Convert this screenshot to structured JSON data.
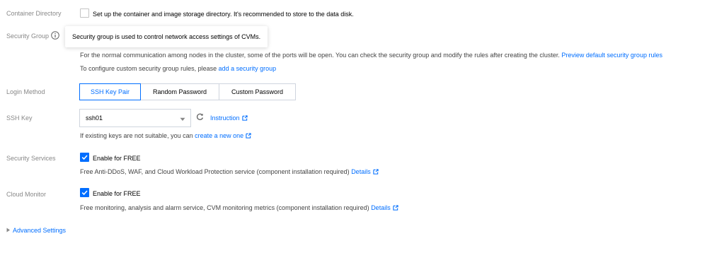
{
  "container_directory": {
    "label": "Container Directory",
    "checkbox_text": "Set up the container and image storage directory. It's recommended to store to the data disk.",
    "checked": false
  },
  "security_group": {
    "label": "Security Group",
    "info_icon": "info-circle-icon",
    "tooltip": "Security group is used to control network access settings of CVMs.",
    "description": "For the normal communication among nodes in the cluster, some of the ports will be open. You can check the security group and modify the rules after creating the cluster.",
    "preview_link": "Preview default security group rules",
    "custom_text": "To configure custom security group rules, please",
    "add_link": "add a security group"
  },
  "login_method": {
    "label": "Login Method",
    "options": [
      "SSH Key Pair",
      "Random Password",
      "Custom Password"
    ],
    "selected": "SSH Key Pair"
  },
  "ssh_key": {
    "label": "SSH Key",
    "value": "ssh01",
    "dropdown_icon": "caret-down-icon",
    "refresh_icon": "refresh-icon",
    "instruction_link": "Instruction",
    "hint_text": "If existing keys are not suitable, you can",
    "create_link": "create a new one"
  },
  "security_services": {
    "label": "Security Services",
    "checkbox_text": "Enable for FREE",
    "checked": true,
    "description": "Free Anti-DDoS, WAF, and Cloud Workload Protection service (component installation required)",
    "details_link": "Details"
  },
  "cloud_monitor": {
    "label": "Cloud Monitor",
    "checkbox_text": "Enable for FREE",
    "checked": true,
    "description": "Free monitoring, analysis and alarm service, CVM monitoring metrics (component installation required)",
    "details_link": "Details"
  },
  "advanced_settings": {
    "label": "Advanced Settings",
    "icon": "caret-right-icon"
  },
  "colors": {
    "accent": "#006eff",
    "label": "#888888"
  }
}
